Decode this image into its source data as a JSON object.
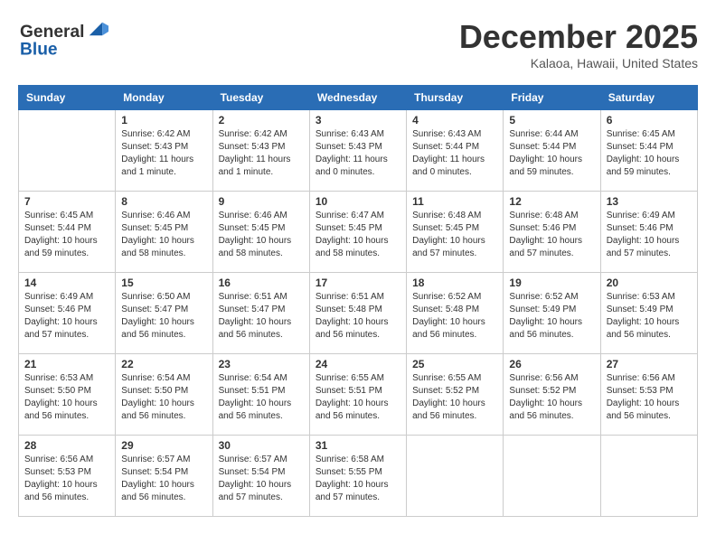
{
  "header": {
    "logo_general": "General",
    "logo_blue": "Blue",
    "month_title": "December 2025",
    "location": "Kalaoa, Hawaii, United States"
  },
  "columns": [
    "Sunday",
    "Monday",
    "Tuesday",
    "Wednesday",
    "Thursday",
    "Friday",
    "Saturday"
  ],
  "weeks": [
    [
      {
        "day": "",
        "empty": true
      },
      {
        "day": "1",
        "sunrise": "Sunrise: 6:42 AM",
        "sunset": "Sunset: 5:43 PM",
        "daylight": "Daylight: 11 hours and 1 minute."
      },
      {
        "day": "2",
        "sunrise": "Sunrise: 6:42 AM",
        "sunset": "Sunset: 5:43 PM",
        "daylight": "Daylight: 11 hours and 1 minute."
      },
      {
        "day": "3",
        "sunrise": "Sunrise: 6:43 AM",
        "sunset": "Sunset: 5:43 PM",
        "daylight": "Daylight: 11 hours and 0 minutes."
      },
      {
        "day": "4",
        "sunrise": "Sunrise: 6:43 AM",
        "sunset": "Sunset: 5:44 PM",
        "daylight": "Daylight: 11 hours and 0 minutes."
      },
      {
        "day": "5",
        "sunrise": "Sunrise: 6:44 AM",
        "sunset": "Sunset: 5:44 PM",
        "daylight": "Daylight: 10 hours and 59 minutes."
      },
      {
        "day": "6",
        "sunrise": "Sunrise: 6:45 AM",
        "sunset": "Sunset: 5:44 PM",
        "daylight": "Daylight: 10 hours and 59 minutes."
      }
    ],
    [
      {
        "day": "7",
        "sunrise": "Sunrise: 6:45 AM",
        "sunset": "Sunset: 5:44 PM",
        "daylight": "Daylight: 10 hours and 59 minutes."
      },
      {
        "day": "8",
        "sunrise": "Sunrise: 6:46 AM",
        "sunset": "Sunset: 5:45 PM",
        "daylight": "Daylight: 10 hours and 58 minutes."
      },
      {
        "day": "9",
        "sunrise": "Sunrise: 6:46 AM",
        "sunset": "Sunset: 5:45 PM",
        "daylight": "Daylight: 10 hours and 58 minutes."
      },
      {
        "day": "10",
        "sunrise": "Sunrise: 6:47 AM",
        "sunset": "Sunset: 5:45 PM",
        "daylight": "Daylight: 10 hours and 58 minutes."
      },
      {
        "day": "11",
        "sunrise": "Sunrise: 6:48 AM",
        "sunset": "Sunset: 5:45 PM",
        "daylight": "Daylight: 10 hours and 57 minutes."
      },
      {
        "day": "12",
        "sunrise": "Sunrise: 6:48 AM",
        "sunset": "Sunset: 5:46 PM",
        "daylight": "Daylight: 10 hours and 57 minutes."
      },
      {
        "day": "13",
        "sunrise": "Sunrise: 6:49 AM",
        "sunset": "Sunset: 5:46 PM",
        "daylight": "Daylight: 10 hours and 57 minutes."
      }
    ],
    [
      {
        "day": "14",
        "sunrise": "Sunrise: 6:49 AM",
        "sunset": "Sunset: 5:46 PM",
        "daylight": "Daylight: 10 hours and 57 minutes."
      },
      {
        "day": "15",
        "sunrise": "Sunrise: 6:50 AM",
        "sunset": "Sunset: 5:47 PM",
        "daylight": "Daylight: 10 hours and 56 minutes."
      },
      {
        "day": "16",
        "sunrise": "Sunrise: 6:51 AM",
        "sunset": "Sunset: 5:47 PM",
        "daylight": "Daylight: 10 hours and 56 minutes."
      },
      {
        "day": "17",
        "sunrise": "Sunrise: 6:51 AM",
        "sunset": "Sunset: 5:48 PM",
        "daylight": "Daylight: 10 hours and 56 minutes."
      },
      {
        "day": "18",
        "sunrise": "Sunrise: 6:52 AM",
        "sunset": "Sunset: 5:48 PM",
        "daylight": "Daylight: 10 hours and 56 minutes."
      },
      {
        "day": "19",
        "sunrise": "Sunrise: 6:52 AM",
        "sunset": "Sunset: 5:49 PM",
        "daylight": "Daylight: 10 hours and 56 minutes."
      },
      {
        "day": "20",
        "sunrise": "Sunrise: 6:53 AM",
        "sunset": "Sunset: 5:49 PM",
        "daylight": "Daylight: 10 hours and 56 minutes."
      }
    ],
    [
      {
        "day": "21",
        "sunrise": "Sunrise: 6:53 AM",
        "sunset": "Sunset: 5:50 PM",
        "daylight": "Daylight: 10 hours and 56 minutes."
      },
      {
        "day": "22",
        "sunrise": "Sunrise: 6:54 AM",
        "sunset": "Sunset: 5:50 PM",
        "daylight": "Daylight: 10 hours and 56 minutes."
      },
      {
        "day": "23",
        "sunrise": "Sunrise: 6:54 AM",
        "sunset": "Sunset: 5:51 PM",
        "daylight": "Daylight: 10 hours and 56 minutes."
      },
      {
        "day": "24",
        "sunrise": "Sunrise: 6:55 AM",
        "sunset": "Sunset: 5:51 PM",
        "daylight": "Daylight: 10 hours and 56 minutes."
      },
      {
        "day": "25",
        "sunrise": "Sunrise: 6:55 AM",
        "sunset": "Sunset: 5:52 PM",
        "daylight": "Daylight: 10 hours and 56 minutes."
      },
      {
        "day": "26",
        "sunrise": "Sunrise: 6:56 AM",
        "sunset": "Sunset: 5:52 PM",
        "daylight": "Daylight: 10 hours and 56 minutes."
      },
      {
        "day": "27",
        "sunrise": "Sunrise: 6:56 AM",
        "sunset": "Sunset: 5:53 PM",
        "daylight": "Daylight: 10 hours and 56 minutes."
      }
    ],
    [
      {
        "day": "28",
        "sunrise": "Sunrise: 6:56 AM",
        "sunset": "Sunset: 5:53 PM",
        "daylight": "Daylight: 10 hours and 56 minutes."
      },
      {
        "day": "29",
        "sunrise": "Sunrise: 6:57 AM",
        "sunset": "Sunset: 5:54 PM",
        "daylight": "Daylight: 10 hours and 56 minutes."
      },
      {
        "day": "30",
        "sunrise": "Sunrise: 6:57 AM",
        "sunset": "Sunset: 5:54 PM",
        "daylight": "Daylight: 10 hours and 57 minutes."
      },
      {
        "day": "31",
        "sunrise": "Sunrise: 6:58 AM",
        "sunset": "Sunset: 5:55 PM",
        "daylight": "Daylight: 10 hours and 57 minutes."
      },
      {
        "day": "",
        "empty": true
      },
      {
        "day": "",
        "empty": true
      },
      {
        "day": "",
        "empty": true
      }
    ]
  ]
}
